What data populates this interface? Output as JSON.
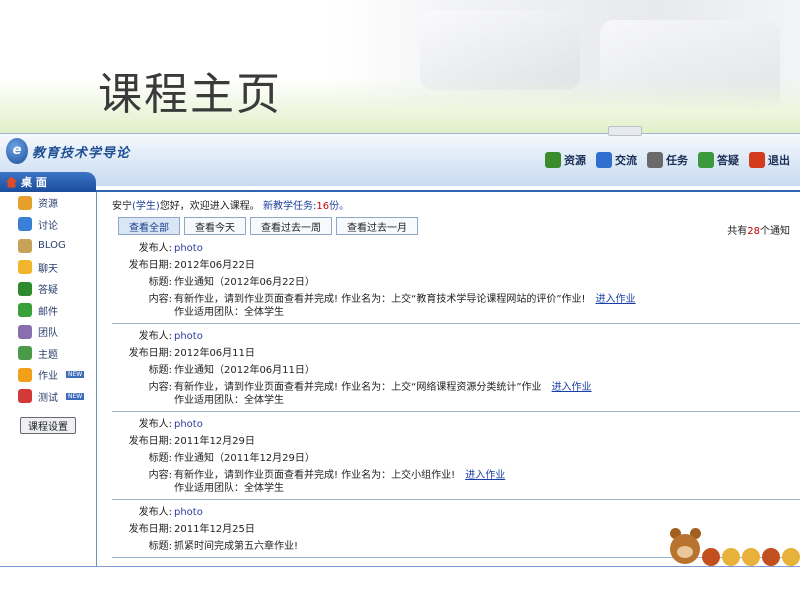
{
  "slide": {
    "title": "课程主页"
  },
  "header": {
    "app_title": "教育技术学导论",
    "logo_letter": "e",
    "nav": [
      {
        "label": "资源",
        "icon": "resource-icon",
        "color": "#3a8b2a"
      },
      {
        "label": "交流",
        "icon": "exchange-icon",
        "color": "#2f6fd0"
      },
      {
        "label": "任务",
        "icon": "task-icon",
        "color": "#6a6a6a"
      },
      {
        "label": "答疑",
        "icon": "qa-icon",
        "color": "#3c9a3c"
      },
      {
        "label": "退出",
        "icon": "exit-icon",
        "color": "#d33b1c"
      }
    ]
  },
  "desk_tab": {
    "label": "桌 面"
  },
  "sidebar": {
    "items": [
      {
        "label": "资源",
        "icon": "resource-icon",
        "color": "#e5a02b"
      },
      {
        "label": "讨论",
        "icon": "discussion-icon",
        "color": "#3a7fd6"
      },
      {
        "label": "BLOG",
        "icon": "blog-icon",
        "color": "#c7a35a"
      },
      {
        "label": "聊天",
        "icon": "chat-icon",
        "color": "#f0b72c"
      },
      {
        "label": "答疑",
        "icon": "qa-icon",
        "color": "#2e8a2e"
      },
      {
        "label": "邮件",
        "icon": "mail-icon",
        "color": "#3aa13a"
      },
      {
        "label": "团队",
        "icon": "team-icon",
        "color": "#8a6fb0"
      },
      {
        "label": "主题",
        "icon": "topic-icon",
        "color": "#4a9a4a"
      },
      {
        "label": "作业",
        "icon": "homework-icon",
        "color": "#f2a01a",
        "badge": "NEW"
      },
      {
        "label": "测试",
        "icon": "test-icon",
        "color": "#d23a3a",
        "badge": "NEW"
      }
    ],
    "course_settings": "课程设置"
  },
  "welcome": {
    "prefix": "安宁",
    "role": "(学生)",
    "middle": "您好，欢迎进入课程。",
    "task_label": "新教学任务:",
    "task_count": "16",
    "suffix": "份。"
  },
  "filter_tabs": [
    "查看全部",
    "查看今天",
    "查看过去一周",
    "查看过去一月"
  ],
  "total": {
    "prefix": "共有",
    "count": "28",
    "suffix": "个通知"
  },
  "notices": [
    {
      "publisher_label": "发布人:",
      "publisher": "photo",
      "date_label": "发布日期:",
      "date": "2012年06月22日",
      "title_label": "标题:",
      "title": "作业通知（2012年06月22日）",
      "content_label": "内容:",
      "content": "有新作业，请到作业页面查看并完成! 作业名为：上交“教育技术学导论课程网站的评价”作业!",
      "link": "进入作业",
      "team": "作业适用团队：全体学生"
    },
    {
      "publisher_label": "发布人:",
      "publisher": "photo",
      "date_label": "发布日期:",
      "date": "2012年06月11日",
      "title_label": "标题:",
      "title": "作业通知（2012年06月11日）",
      "content_label": "内容:",
      "content": "有新作业，请到作业页面查看并完成! 作业名为：上交“网络课程资源分类统计”作业",
      "link": "进入作业",
      "team": "作业适用团队：全体学生"
    },
    {
      "publisher_label": "发布人:",
      "publisher": "photo",
      "date_label": "发布日期:",
      "date": "2011年12月29日",
      "title_label": "标题:",
      "title": "作业通知（2011年12月29日）",
      "content_label": "内容:",
      "content": "有新作业，请到作业页面查看并完成! 作业名为：上交小组作业!",
      "link": "进入作业",
      "team": "作业适用团队：全体学生"
    },
    {
      "publisher_label": "发布人:",
      "publisher": "photo",
      "date_label": "发布日期:",
      "date": "2011年12月25日",
      "title_label": "标题:",
      "title": "抓紧时间完成第五六章作业!"
    }
  ]
}
